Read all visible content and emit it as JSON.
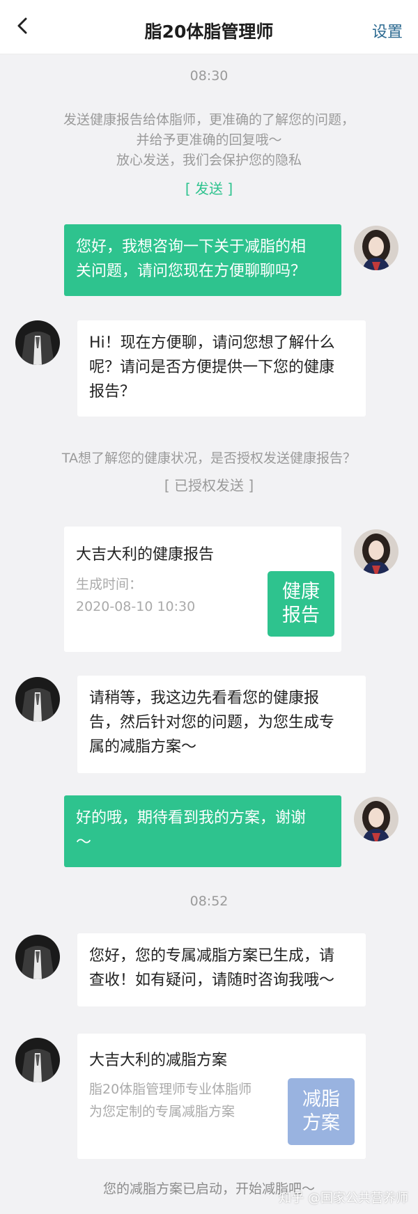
{
  "header": {
    "title": "脂20体脂管理师",
    "settings_label": "设置"
  },
  "timestamps": [
    "08:30",
    "08:52"
  ],
  "notice_send": {
    "lines": [
      "发送健康报告给体脂师，更准确的了解您的问题，",
      "并给予更准确的回复哦～",
      "放心发送，我们会保护您的隐私"
    ],
    "action": "[ 发送 ]"
  },
  "messages": {
    "m1": [
      "您好，我想咨询一下关于减脂的相",
      "关问题，请问您现在方便聊聊吗？"
    ],
    "m2": [
      "Hi！现在方便聊，请问您想了解什么",
      "呢？请问是否方便提供一下您的健康",
      "报告？"
    ],
    "m3": [
      "请稍等，我这边先看看您的健康报",
      "告，然后针对您的问题，为您生成专",
      "属的减脂方案～"
    ],
    "m4": [
      "好的哦，期待看到我的方案，谢谢",
      "～"
    ],
    "m5": [
      "您好，您的专属减脂方案已生成，请",
      "查收！如有疑问，请随时咨询我哦～"
    ]
  },
  "notice_auth": {
    "text": "TA想了解您的健康状况，是否授权发送健康报告？",
    "action": "[ 已授权发送 ]"
  },
  "report_card": {
    "title": "大吉大利的健康报告",
    "time_label": "生成时间：",
    "time_value": "2020-08-10 10:30",
    "button_line1": "健康",
    "button_line2": "报告"
  },
  "plan_card": {
    "title": "大吉大利的减脂方案",
    "desc_line1": "脂20体脂管理师专业体脂师",
    "desc_line2": "为您定制的专属减脂方案",
    "button_line1": "减脂",
    "button_line2": "方案"
  },
  "footer_note": "您的减脂方案已启动，开始减脂吧～",
  "watermark": "知乎 @国家公共营养师",
  "colors": {
    "accent_green": "#2ec38e",
    "plan_button_blue": "#99b3e0",
    "settings_link": "#2c6a91"
  },
  "icons": {
    "back": "chevron-left-icon",
    "user_avatar": "user-avatar",
    "advisor_avatar": "advisor-avatar"
  }
}
